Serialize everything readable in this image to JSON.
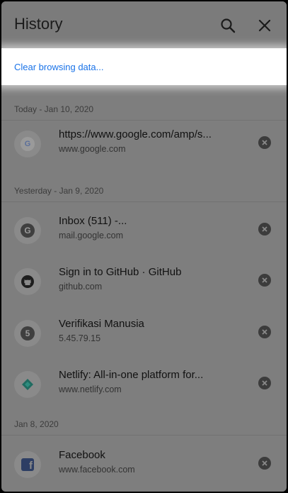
{
  "header": {
    "title": "History",
    "search_icon": "search-icon",
    "close_icon": "close-icon"
  },
  "clear_link": "Clear browsing data...",
  "sections": [
    {
      "label": "Today - Jan 10, 2020",
      "items": [
        {
          "title": "https://www.google.com/amp/s...",
          "url": "www.google.com",
          "favicon": "google-icon"
        }
      ]
    },
    {
      "label": "Yesterday - Jan 9, 2020",
      "items": [
        {
          "title": "Inbox (511) -...",
          "url": "mail.google.com",
          "favicon": "letter-g-icon",
          "favicon_letter": "G"
        },
        {
          "title": "Sign in to GitHub · GitHub",
          "url": "github.com",
          "favicon": "github-icon"
        },
        {
          "title": "Verifikasi Manusia",
          "url": "5.45.79.15",
          "favicon": "letter-5-icon",
          "favicon_letter": "5"
        },
        {
          "title": "Netlify: All-in-one platform for...",
          "url": "www.netlify.com",
          "favicon": "netlify-icon"
        }
      ]
    },
    {
      "label": "Jan 8, 2020",
      "items": [
        {
          "title": "Facebook",
          "url": "www.facebook.com",
          "favicon": "facebook-icon"
        }
      ]
    }
  ],
  "colors": {
    "link": "#1a73e8",
    "overlay": "#7e7e7e"
  }
}
